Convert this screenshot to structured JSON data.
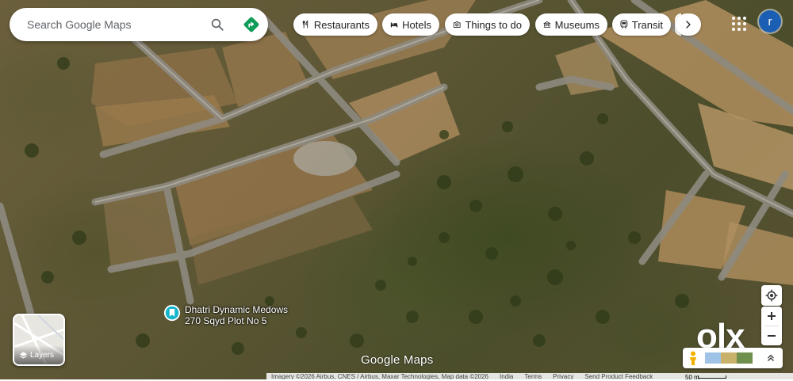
{
  "search": {
    "placeholder": "Search Google Maps"
  },
  "chips": [
    {
      "label": "Restaurants",
      "icon": "fork-knife-icon"
    },
    {
      "label": "Hotels",
      "icon": "bed-icon"
    },
    {
      "label": "Things to do",
      "icon": "camera-icon"
    },
    {
      "label": "Museums",
      "icon": "museum-icon"
    },
    {
      "label": "Transit",
      "icon": "train-icon"
    }
  ],
  "account": {
    "initial": "r"
  },
  "place": {
    "line1": "Dhatri Dynamic Medows",
    "line2": "270 Sqyd Plot No 5"
  },
  "layers": {
    "label": "Layers"
  },
  "logo": {
    "text": "Google Maps"
  },
  "watermark": {
    "text": "olx"
  },
  "footer": {
    "attribution": "Imagery ©2026 Airbus, CNES / Airbus, Maxar Technologies, Map data ©2026",
    "links": [
      "India",
      "Terms",
      "Privacy",
      "Send Product Feedback"
    ],
    "scale": "50 m"
  },
  "colors": {
    "accent": "#1a73e8",
    "directions": "#0f9d58",
    "avatar": "#1a5fb4"
  }
}
